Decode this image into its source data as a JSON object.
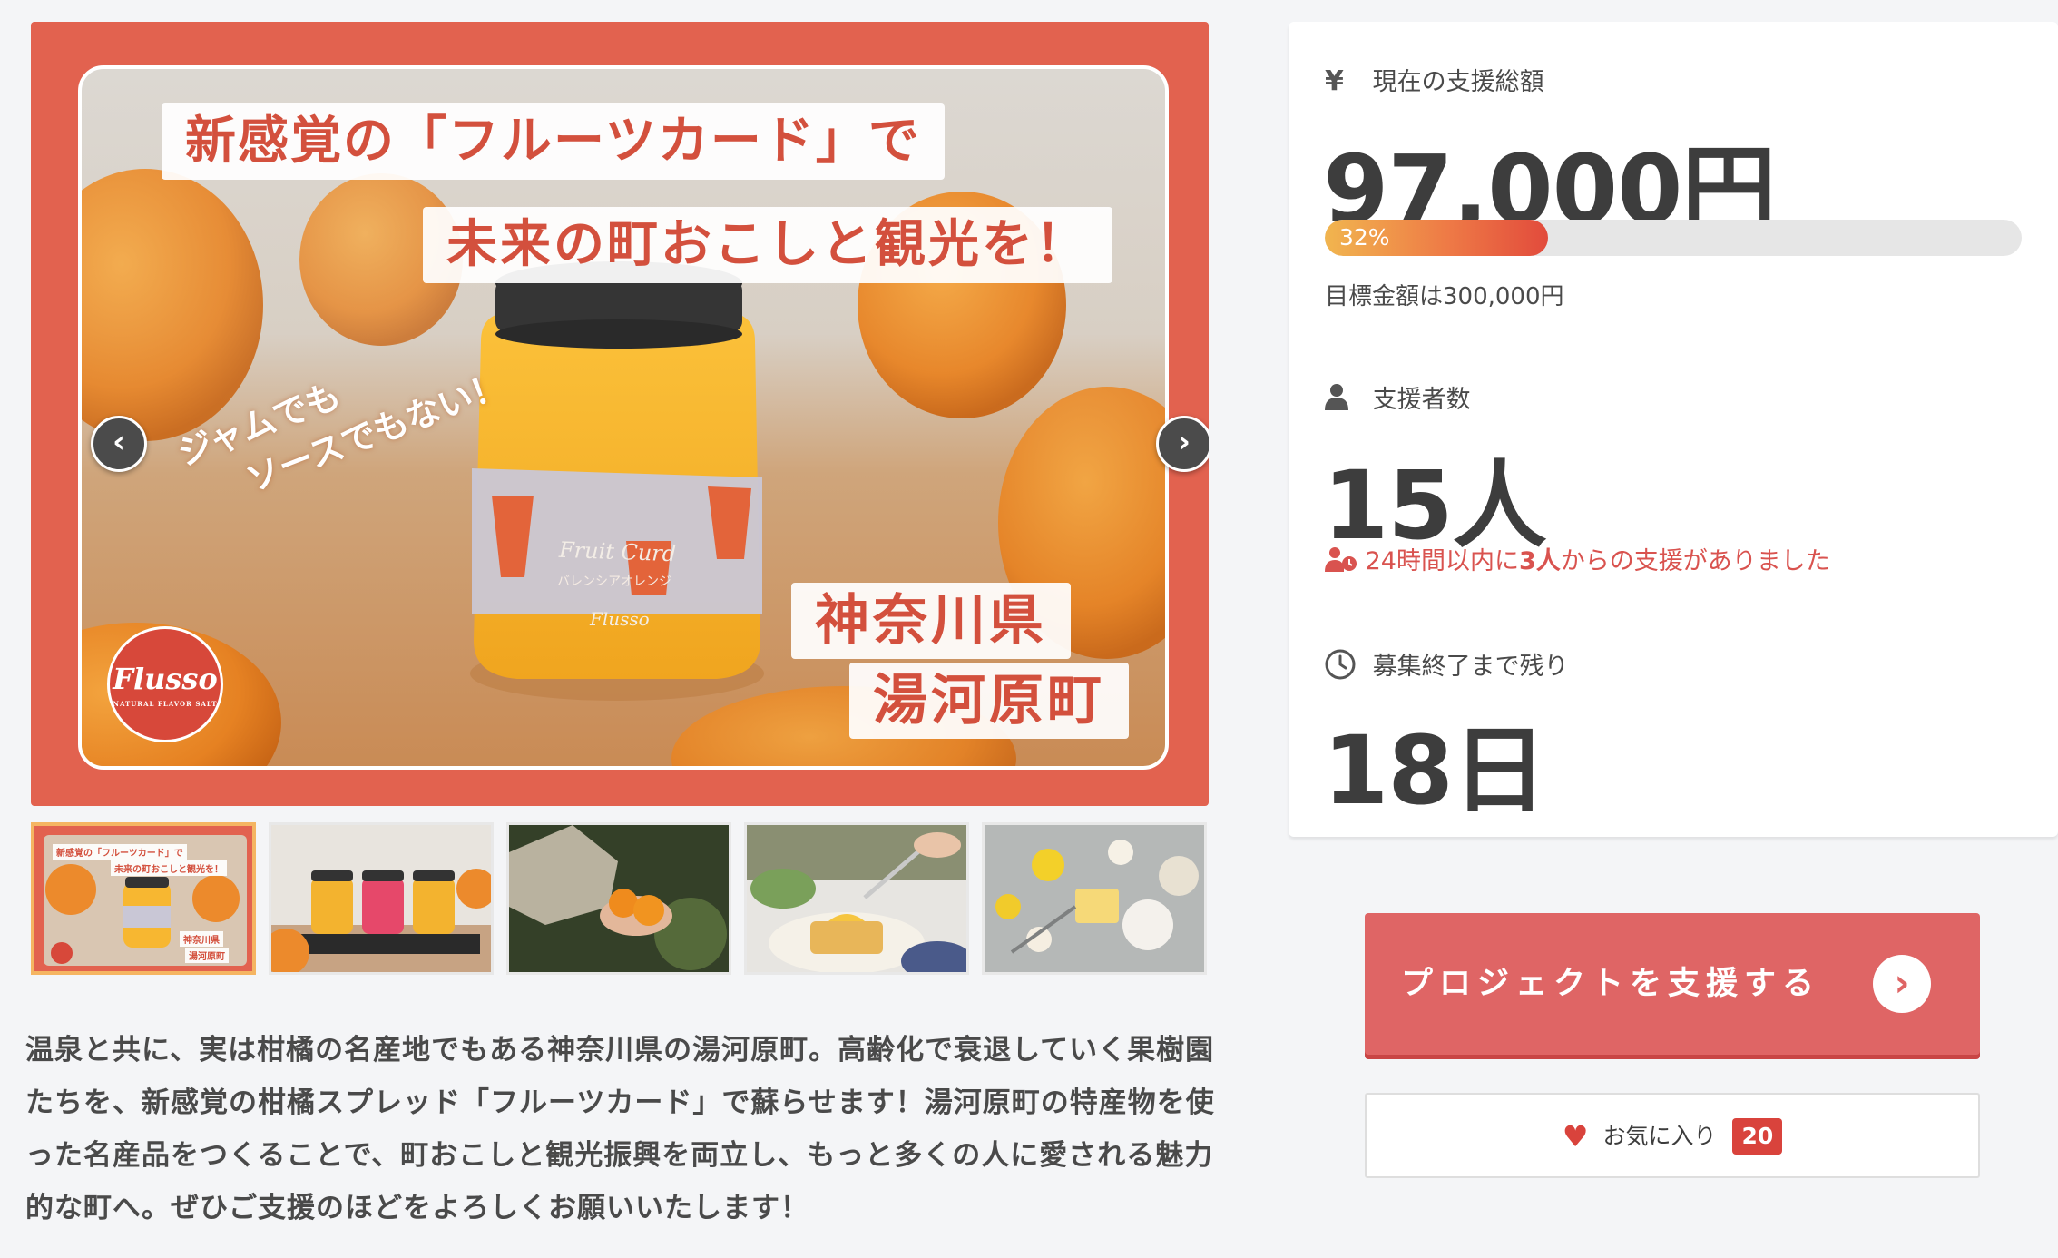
{
  "hero": {
    "banner_line1": "新感覚の「フルーツカード」で",
    "banner_line2": "未来の町おこしと観光を！",
    "slant_line1": "ジャムでも",
    "slant_line2": "ソースでもない！",
    "place_line1": "神奈川県",
    "place_line2": "湯河原町",
    "jar_label": "Fruit Curd",
    "jar_sub": "バレンシアオレンジ",
    "jar_logo": "Flusso",
    "logo_name": "Flusso",
    "logo_tagline": "NATURAL FLAVOR SALT",
    "prev_icon": "chevron-left-icon",
    "next_icon": "chevron-right-icon"
  },
  "thumbnails": [
    {
      "alt": "main-visual",
      "line1": "新感覚の「フルーツカード」で",
      "line2": "未来の町おこしと観光を！",
      "line3": "神奈川県",
      "line4": "湯河原町"
    },
    {
      "alt": "three-jars"
    },
    {
      "alt": "oranges-in-hand"
    },
    {
      "alt": "curd-on-toast"
    },
    {
      "alt": "ingredients"
    }
  ],
  "description": "温泉と共に、実は柑橘の名産地でもある神奈川県の湯河原町。高齢化で衰退していく果樹園たちを、新感覚の柑橘スプレッド「フルーツカード」で蘇らせます！湯河原町の特産物を使った名産品をつくることで、町おこしと観光振興を両立し、もっと多くの人に愛される魅力的な町へ。ぜひご支援のほどをよろしくお願いいたします！",
  "stats": {
    "total_icon": "yen-icon",
    "total_icon_glyph": "¥",
    "total_label": "現在の支援総額",
    "total_amount": "97,000円",
    "progress_percent": 32,
    "progress_label": "32%",
    "goal_text": "目標金額は300,000円",
    "backers_icon": "user-icon",
    "backers_label": "支援者数",
    "backers_count": "15人",
    "recent_prefix": "24時間以内に",
    "recent_count": "3人",
    "recent_suffix": "からの支援がありました",
    "time_icon": "clock-icon",
    "time_label": "募集終了まで残り",
    "time_left": "18日"
  },
  "actions": {
    "support_label": "プロジェクトを支援する",
    "support_icon": "chevron-right-circle-icon",
    "favorite_label": "お気に入り",
    "favorite_count": "20",
    "favorite_icon": "heart-icon"
  },
  "colors": {
    "accent": "#df6565",
    "hero_frame": "#e2624f",
    "progress_start": "#f1b54f",
    "progress_end": "#e24b3c",
    "recent_text": "#d9534f",
    "badge": "#d9433c"
  }
}
